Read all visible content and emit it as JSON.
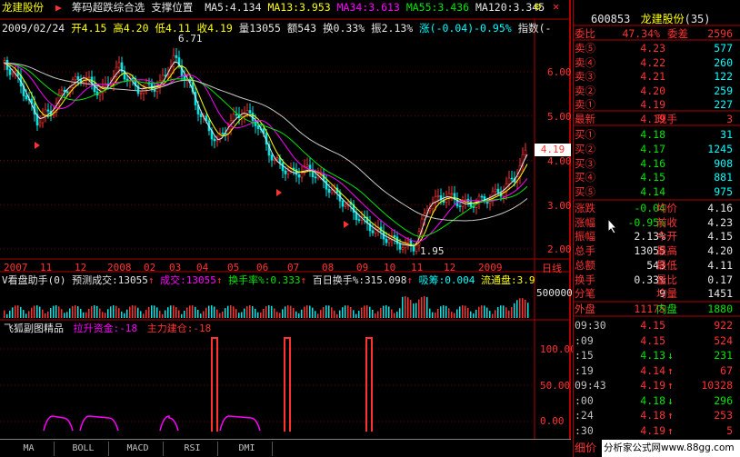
{
  "header": {
    "stock_name": "龙建股份",
    "formula": "筹码超跌综合选 支撑位置",
    "ma5": "MA5:4.134",
    "ma13": "MA13:3.953",
    "ma34": "MA34:3.613",
    "ma55": "MA55:3.436",
    "ma120": "MA120:3.345",
    "date": "2009/02/24",
    "open": "开4.15",
    "high": "高4.20",
    "low": "低4.11",
    "close": "收4.19",
    "volume": "量13055",
    "amount": "额543",
    "turnover": "换0.33%",
    "amplitude": "振2.13%",
    "change": "涨(-0.04)-0.95%",
    "index": "指数(-"
  },
  "price_axis": [
    "6.00",
    "5.00",
    "4.00",
    "3.00",
    "2.00"
  ],
  "annotations": {
    "high": "6.71",
    "low": "1.95",
    "last": "4.19"
  },
  "x_axis": [
    "2007",
    "11",
    "12",
    "2008",
    "02",
    "03",
    "04",
    "05",
    "06",
    "07",
    "08",
    "09",
    "10",
    "11",
    "12",
    "2009"
  ],
  "x_axis_unit": "日线",
  "volume_panel": {
    "title": "V看盘助手(0)",
    "forecast": "预测成交:13055",
    "deal": "成交:13055",
    "turnover_rate": "换手率%:0.333",
    "daily_turnover": "百日换手%:315.098",
    "signal": "吸筹:0.004",
    "float": "流通盘:3.9",
    "axis": "500000"
  },
  "indicator_panel": {
    "title": "飞狐副图精品",
    "lift_fund": "拉升资金:-18",
    "main_position": "主力建仓:-18",
    "axis": [
      "100.00",
      "50.00",
      "0.00"
    ]
  },
  "tabs": [
    "MA",
    "BOLL",
    "MACD",
    "RSI",
    "DMI"
  ],
  "quote": {
    "code": "600853",
    "name": "龙建股份",
    "rank": "(35)",
    "commission_ratio_label": "委比",
    "commission_ratio": "47.34%",
    "commission_diff_label": "委差",
    "commission_diff": "2596",
    "asks": [
      {
        "label": "卖⑤",
        "price": "4.23",
        "vol": "577"
      },
      {
        "label": "卖④",
        "price": "4.22",
        "vol": "260"
      },
      {
        "label": "卖③",
        "price": "4.21",
        "vol": "122"
      },
      {
        "label": "卖②",
        "price": "4.20",
        "vol": "259"
      },
      {
        "label": "卖①",
        "price": "4.19",
        "vol": "227"
      }
    ],
    "last_label": "最新",
    "last": "4.19",
    "now_vol_label": "现手",
    "now_vol": "3",
    "bids": [
      {
        "label": "买①",
        "price": "4.18",
        "vol": "31"
      },
      {
        "label": "买②",
        "price": "4.17",
        "vol": "1245"
      },
      {
        "label": "买③",
        "price": "4.16",
        "vol": "908"
      },
      {
        "label": "买④",
        "price": "4.15",
        "vol": "881"
      },
      {
        "label": "买⑤",
        "price": "4.14",
        "vol": "975"
      }
    ],
    "stats": [
      {
        "l1": "涨跌",
        "v1": "-0.04",
        "l2": "均价",
        "v2": "4.16"
      },
      {
        "l1": "涨幅",
        "v1": "-0.95%",
        "l2": "前收",
        "v2": "4.23"
      },
      {
        "l1": "振幅",
        "v1": "2.13%",
        "l2": "今开",
        "v2": "4.15"
      },
      {
        "l1": "总手",
        "v1": "13055",
        "l2": "最高",
        "v2": "4.20"
      },
      {
        "l1": "总额",
        "v1": "543",
        "l2": "最低",
        "v2": "4.11"
      },
      {
        "l1": "换手",
        "v1": "0.33%",
        "l2": "量比",
        "v2": "0.17"
      },
      {
        "l1": "分笔",
        "v1": "9",
        "l2": "均量",
        "v2": "1451"
      }
    ],
    "outer_label": "外盘",
    "outer": "11175",
    "inner_label": "内盘",
    "inner": "1880"
  },
  "ticks": [
    {
      "time": "09:30",
      "price": "4.15",
      "arrow": "",
      "vol": "922"
    },
    {
      "time": ":09",
      "price": "4.15",
      "arrow": "",
      "vol": "524"
    },
    {
      "time": ":15",
      "price": "4.13",
      "arrow": "↓",
      "vol": "231"
    },
    {
      "time": ":19",
      "price": "4.14",
      "arrow": "↑",
      "vol": "67"
    },
    {
      "time": "09:43",
      "price": "4.19",
      "arrow": "↑",
      "vol": "10328"
    },
    {
      "time": ":00",
      "price": "4.18",
      "arrow": "↓",
      "vol": "296"
    },
    {
      "time": ":24",
      "price": "4.18",
      "arrow": "↑",
      "vol": "253"
    },
    {
      "time": ":30",
      "price": "4.19",
      "arrow": "↑",
      "vol": "5"
    }
  ],
  "ticks_footer": "细价",
  "watermark": "分析家公式网www.88gg.com"
}
